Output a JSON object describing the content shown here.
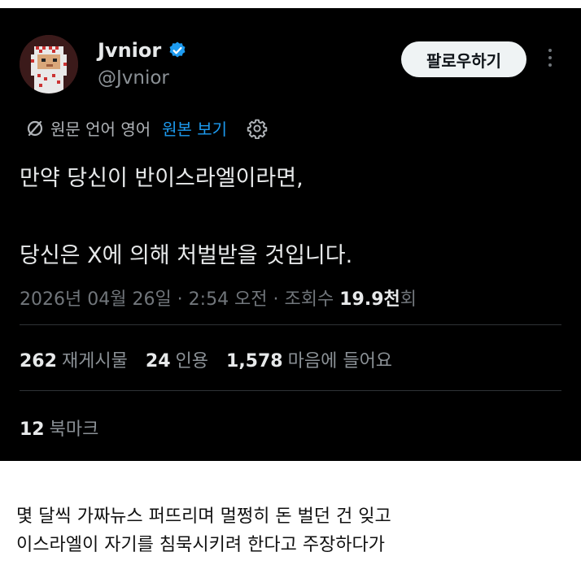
{
  "user": {
    "display_name": "Jvnior",
    "handle": "@Jvnior",
    "verified_icon": "verified-badge-icon",
    "avatar_icon": "pixel-avatar-icon"
  },
  "follow_button": "팔로우하기",
  "more_icon": "more-vertical-icon",
  "translation": {
    "icon": "translate-icon",
    "label": "원문 언어 영어",
    "view_original": "원본 보기",
    "settings_icon": "gear-icon"
  },
  "tweet_lines": [
    "만약 당신이 반이스라엘이라면,",
    "당신은 X에 의해 처벌받을 것입니다."
  ],
  "meta": {
    "datetime": "2026년 04월 26일 · 2:54 오전 · 조회수 ",
    "views": "19.9천",
    "views_suffix": "회"
  },
  "stats": {
    "retweets_count": "262",
    "retweets_label": "재게시물",
    "quotes_count": "24",
    "quotes_label": "인용",
    "likes_count": "1,578",
    "likes_label": "마음에 들어요",
    "bookmarks_count": "12",
    "bookmarks_label": "북마크"
  },
  "caption_lines": [
    "몇 달씩 가짜뉴스 퍼뜨리며 멀쩡히 돈 벌던 건 잊고",
    "이스라엘이 자기를 침묵시키려 한다고 주장하다가"
  ],
  "colors": {
    "background": "#000000",
    "link": "#1d9bf0",
    "verified": "#1d9bf0",
    "muted": "#71767b"
  }
}
